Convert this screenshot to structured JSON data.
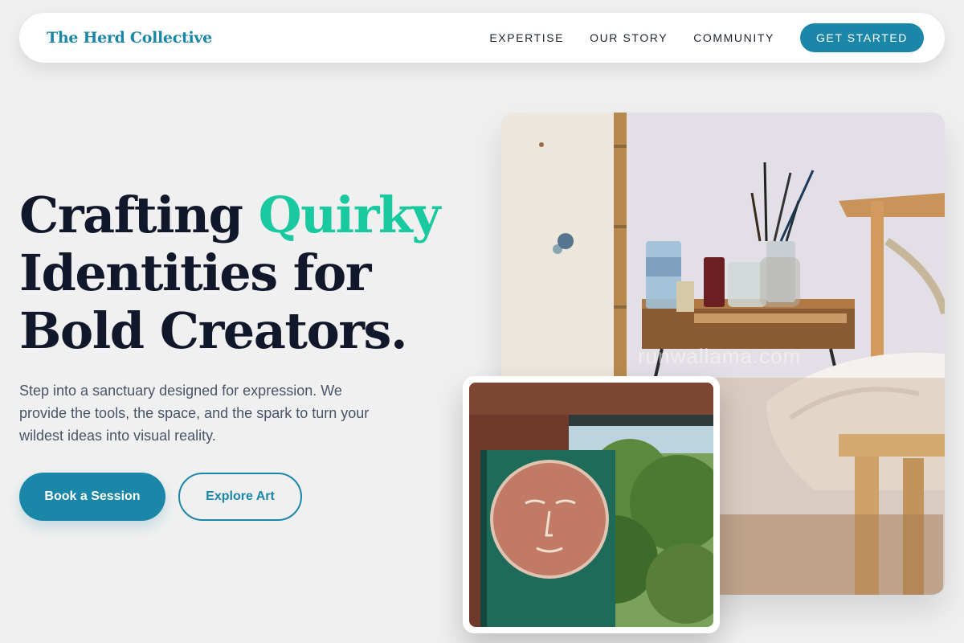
{
  "navbar": {
    "brand": "The Herd Collective",
    "links": [
      {
        "label": "EXPERTISE"
      },
      {
        "label": "OUR STORY"
      },
      {
        "label": "COMMUNITY"
      }
    ],
    "cta_label": "GET STARTED"
  },
  "hero": {
    "title_part1": "Crafting ",
    "title_accent": "Quirky",
    "title_part2": " Identities for Bold Creators.",
    "subtitle": "Step into a sanctuary designed for expression. We provide the tools, the space, and the spark to turn your wildest ideas into visual reality.",
    "primary_button": "Book a Session",
    "secondary_button": "Explore Art"
  },
  "images": {
    "main_watermark": "runwallama.com"
  },
  "colors": {
    "brand": "#1a86a8",
    "accent": "#19c9a0",
    "heading": "#12182b",
    "body_text": "#495468",
    "background": "#f0f0f0"
  }
}
